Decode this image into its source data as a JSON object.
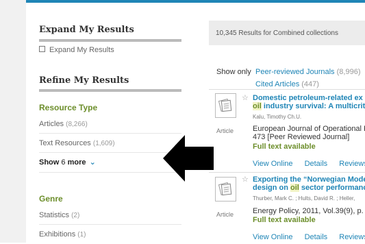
{
  "facets": {
    "expand": {
      "title": "Expand My Results",
      "checkbox_label": "Expand My Results"
    },
    "refine": {
      "title": "Refine My Results"
    },
    "resource_type": {
      "heading": "Resource Type",
      "items": [
        {
          "label": "Articles",
          "count": "(8,266)"
        },
        {
          "label": "Text Resources",
          "count": "(1,609)"
        }
      ],
      "show_more": {
        "prefix": "Show",
        "num": "6",
        "suffix": "more",
        "chevron": "⌄"
      }
    },
    "genre": {
      "heading": "Genre",
      "items": [
        {
          "label": "Statistics",
          "count": "(2)"
        },
        {
          "label": "Exhibitions",
          "count": "(1)"
        }
      ]
    }
  },
  "results": {
    "summary": "10,345 Results for Combined collections",
    "show_only_label": "Show only",
    "filters": [
      {
        "label": "Peer-reviewed Journals",
        "count": "(8,996)"
      },
      {
        "label": "Cited Articles",
        "count": "(447)"
      }
    ],
    "records": [
      {
        "type": "Article",
        "title_line1": "Domestic petroleum-related ex",
        "title_line2_hl": "oil",
        "title_line2_rest": " industry survival: A multicrit",
        "authors": "Kalu, Timothy Ch.U.",
        "source_line1": "European Journal of Operational R",
        "source_line2": "473 [Peer Reviewed Journal]",
        "fulltext": "Full text available",
        "actions": [
          "View Online",
          "Details",
          "Reviews"
        ]
      },
      {
        "type": "Article",
        "title_line1": "Exporting the “Norwegian Mode",
        "title_line2_pre": "design on ",
        "title_line2_hl": "oil",
        "title_line2_rest": " sector performanc",
        "authors": "Thurber, Mark C. ; Hults, David R. ; Heller,",
        "source_line1": "Energy Policy, 2011, Vol.39(9), p.",
        "fulltext": "Full text available",
        "actions": [
          "View Online",
          "Details",
          "Reviews"
        ]
      }
    ]
  },
  "colors": {
    "accent": "#1f85b6",
    "facet_green": "#6c8e2b",
    "rule_gray": "#bbbbbb"
  },
  "icons": {
    "record": "document-stack-icon",
    "arrow": "left-arrow-icon",
    "star": "star-outline-icon",
    "chevron": "chevron-down-icon"
  }
}
